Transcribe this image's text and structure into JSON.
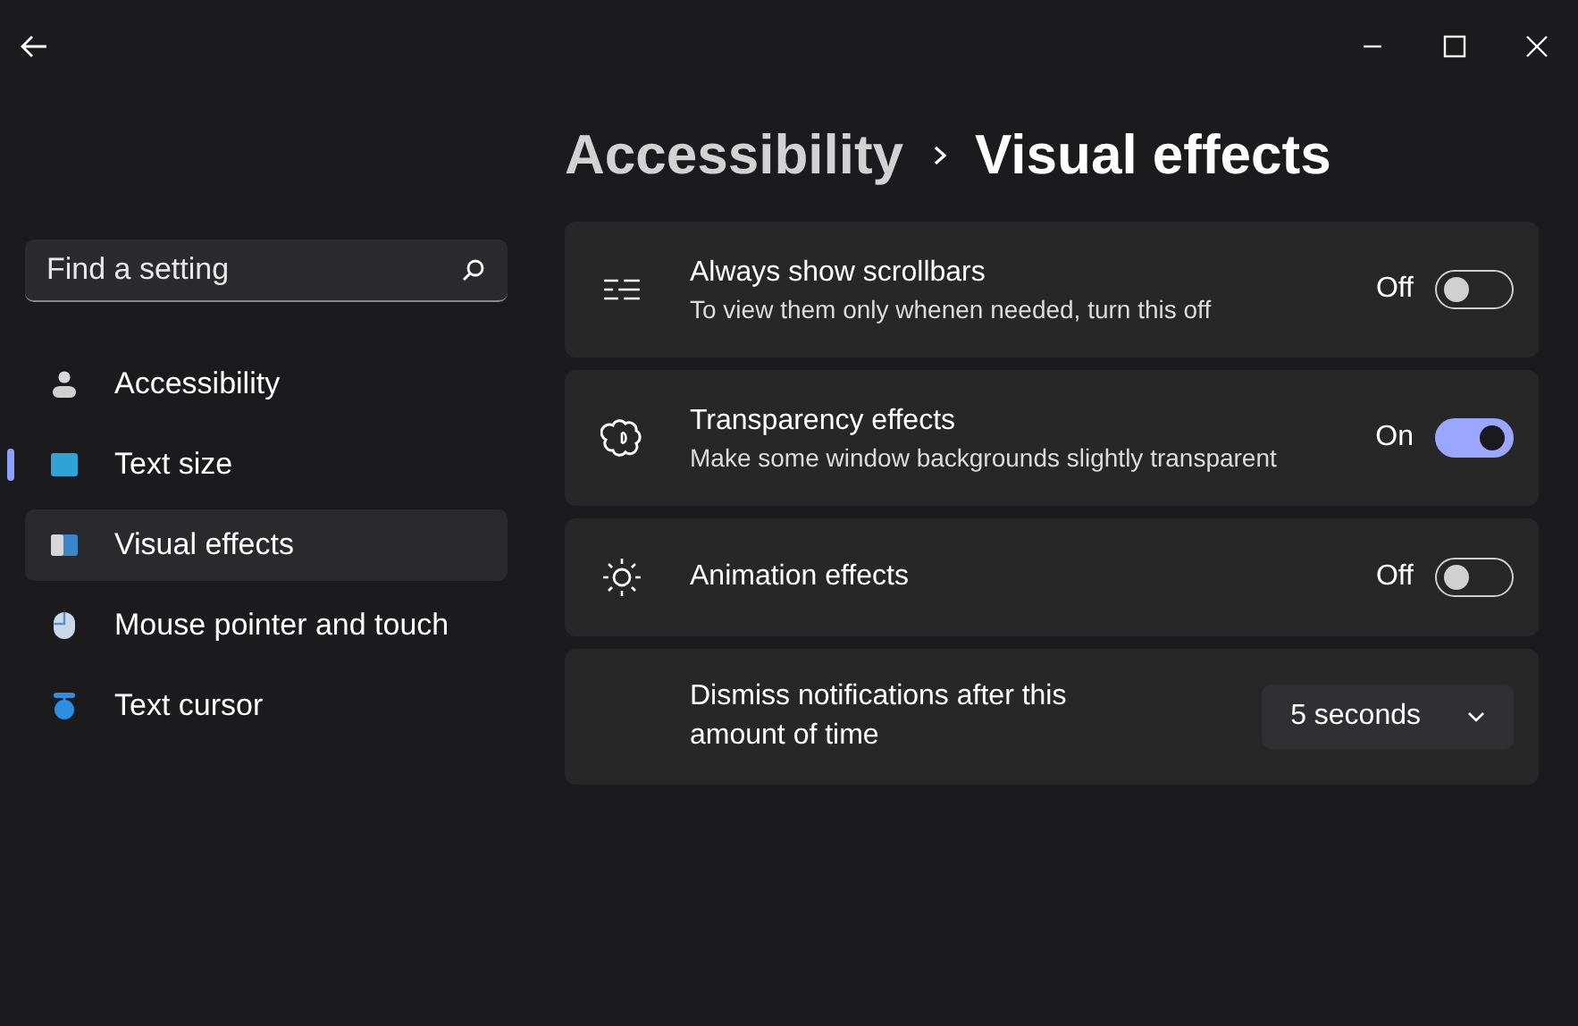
{
  "breadcrumb": {
    "parent": "Accessibility",
    "current": "Visual effects"
  },
  "search": {
    "placeholder": "Find a setting"
  },
  "sidebar": {
    "items": [
      {
        "label": "Accessibility",
        "selected": false,
        "hovered": false
      },
      {
        "label": "Text size",
        "selected": true,
        "hovered": false
      },
      {
        "label": "Visual effects",
        "selected": false,
        "hovered": true
      },
      {
        "label": "Mouse pointer and touch",
        "selected": false,
        "hovered": false
      },
      {
        "label": "Text cursor",
        "selected": false,
        "hovered": false
      }
    ]
  },
  "settings": [
    {
      "kind": "toggle",
      "title": "Always show scrollbars",
      "description": "To view them only whenen needed, turn this off",
      "on": false,
      "state_label": "Off"
    },
    {
      "kind": "toggle",
      "title": "Transparency effects",
      "description": "Make some window backgrounds slightly transparent",
      "on": true,
      "state_label": "On"
    },
    {
      "kind": "toggle",
      "title": "Animation effects",
      "on": false,
      "state_label": "Off"
    },
    {
      "kind": "dropdown",
      "title": "Dismiss notifications after this amount of time",
      "value": "5 seconds"
    }
  ]
}
